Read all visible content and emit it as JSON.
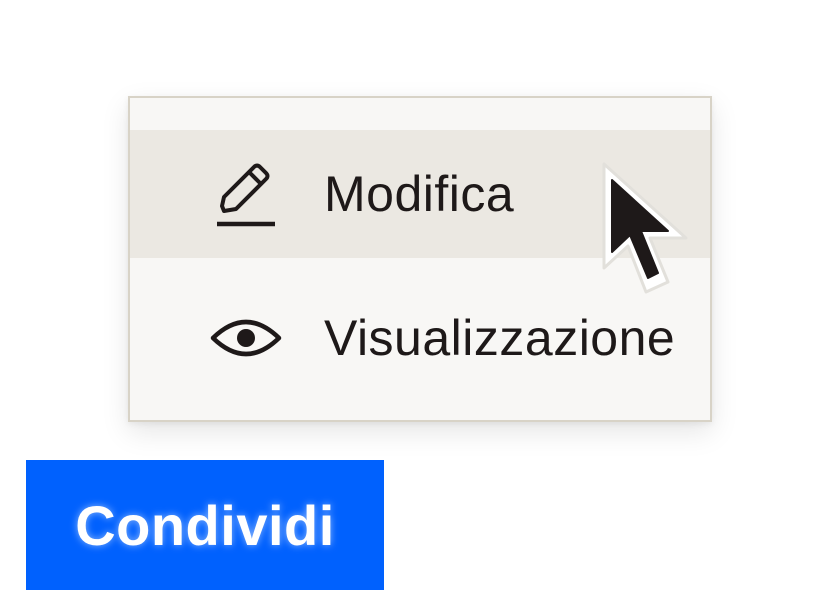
{
  "menu": {
    "items": [
      {
        "label": "Modifica",
        "icon": "pencil-icon",
        "highlighted": true
      },
      {
        "label": "Visualizzazione",
        "icon": "eye-icon",
        "highlighted": false
      }
    ]
  },
  "share_button": {
    "label": "Condividi",
    "color": "#0061fe"
  },
  "colors": {
    "menu_background": "#f8f7f5",
    "menu_highlight": "#ebe8e2",
    "menu_border": "#d8d3c7",
    "text": "#1e1919"
  },
  "cursor": {
    "icon": "mouse-pointer-icon"
  }
}
